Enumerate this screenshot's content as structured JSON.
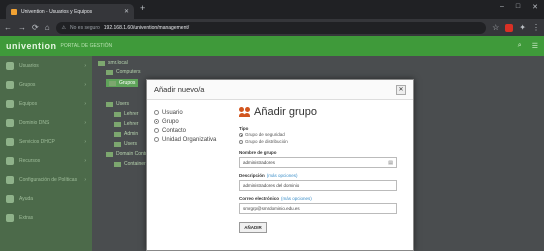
{
  "browser": {
    "tab_title": "Univention - Usuarios y Equipos",
    "address_prefix": "No es seguro",
    "url": "192.168.1.60/univention/management/"
  },
  "app": {
    "logo": "univention",
    "subtitle": "PORTAL DE GESTIÓN"
  },
  "sidebar": {
    "items": [
      {
        "label": "Usuarios"
      },
      {
        "label": "Grupos"
      },
      {
        "label": "Equipos"
      },
      {
        "label": "Dominio DNS"
      },
      {
        "label": "Servicios DHCP"
      },
      {
        "label": "Recursos"
      },
      {
        "label": "Configuración de Políticas"
      },
      {
        "label": "Ayuda"
      },
      {
        "label": "Extras"
      }
    ]
  },
  "tree": {
    "nodes": [
      {
        "label": "smr.local"
      },
      {
        "label": "Computers"
      },
      {
        "label": "Grupos"
      },
      {
        "label": "Users"
      },
      {
        "label": "Lehrer"
      },
      {
        "label": "Lehrer"
      },
      {
        "label": "Admin"
      },
      {
        "label": "Users"
      },
      {
        "label": "Domain Controllers"
      },
      {
        "label": "Container"
      }
    ]
  },
  "dialog": {
    "title": "Añadir nuevo/a",
    "types": [
      {
        "label": "Usuario",
        "selected": false
      },
      {
        "label": "Grupo",
        "selected": true
      },
      {
        "label": "Contacto",
        "selected": false
      },
      {
        "label": "Unidad Organizativa",
        "selected": false
      }
    ],
    "form_title": "Añadir grupo",
    "tipo_label": "Tipo",
    "tipo_options": [
      {
        "label": "Grupo de seguridad",
        "selected": true
      },
      {
        "label": "Grupo de distribución",
        "selected": false
      }
    ],
    "group_name_label": "Nombre de grupo",
    "group_name_value": "administradores",
    "description_label": "Descripción",
    "description_link": "(más opciones)",
    "description_value": "administradores del dominio",
    "email_label": "Correo electrónico",
    "email_link": "(más opciones)",
    "email_value": "smrgrp@smrdominio.edu.es",
    "submit_label": "AÑADIR"
  }
}
